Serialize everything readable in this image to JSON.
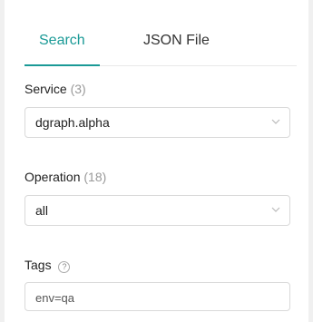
{
  "tabs": {
    "search_label": "Search",
    "json_label": "JSON File"
  },
  "service": {
    "label": "Service",
    "count": "(3)",
    "selected": "dgraph.alpha"
  },
  "operation": {
    "label": "Operation",
    "count": "(18)",
    "selected": "all"
  },
  "tags": {
    "label": "Tags",
    "help_glyph": "?",
    "value": "env=qa"
  },
  "colors": {
    "accent": "#1a9a96",
    "border": "#d9d9d9",
    "background": "#f0f0f0",
    "panel": "#ffffff"
  },
  "icons": {
    "select_arrow": "chevron-down-icon",
    "help": "question-circle-icon"
  }
}
